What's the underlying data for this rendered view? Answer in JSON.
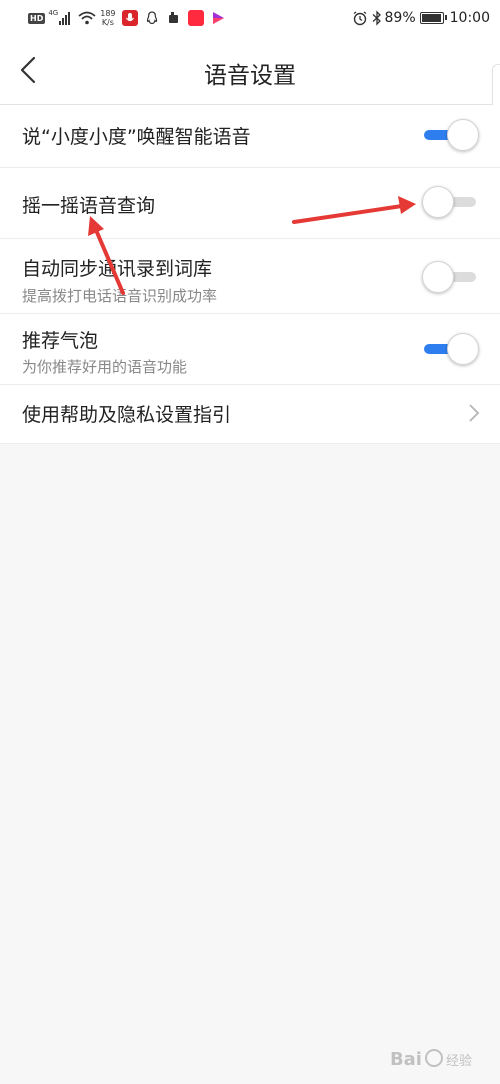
{
  "status_bar": {
    "hd": "HD",
    "network": "4G",
    "speed_value": "189",
    "speed_unit": "K/s",
    "battery_percent": "89%",
    "battery_level": 0.89,
    "time": "10:00",
    "app_icons": [
      "baidu-voice-icon",
      "qq-icon",
      "chat-icon",
      "app-red-icon",
      "video-app-icon"
    ]
  },
  "header": {
    "title": "语音设置"
  },
  "settings": {
    "wake_word": {
      "label": "说“小度小度”唤醒智能语音",
      "enabled": true
    },
    "shake_query": {
      "label": "摇一摇语音查询",
      "enabled": false
    },
    "sync_contacts": {
      "label": "自动同步通讯录到词库",
      "sub": "提高拨打电话语音识别成功率",
      "enabled": false
    },
    "bubble": {
      "label": "推荐气泡",
      "sub": "为你推荐好用的语音功能",
      "enabled": true
    },
    "help": {
      "label": "使用帮助及隐私设置指引"
    }
  },
  "watermark": {
    "text": "Bai",
    "suffix": "经验"
  },
  "colors": {
    "accent": "#2f7ef0",
    "annotation_arrow": "#e53935",
    "background": "#f7f7f7"
  }
}
